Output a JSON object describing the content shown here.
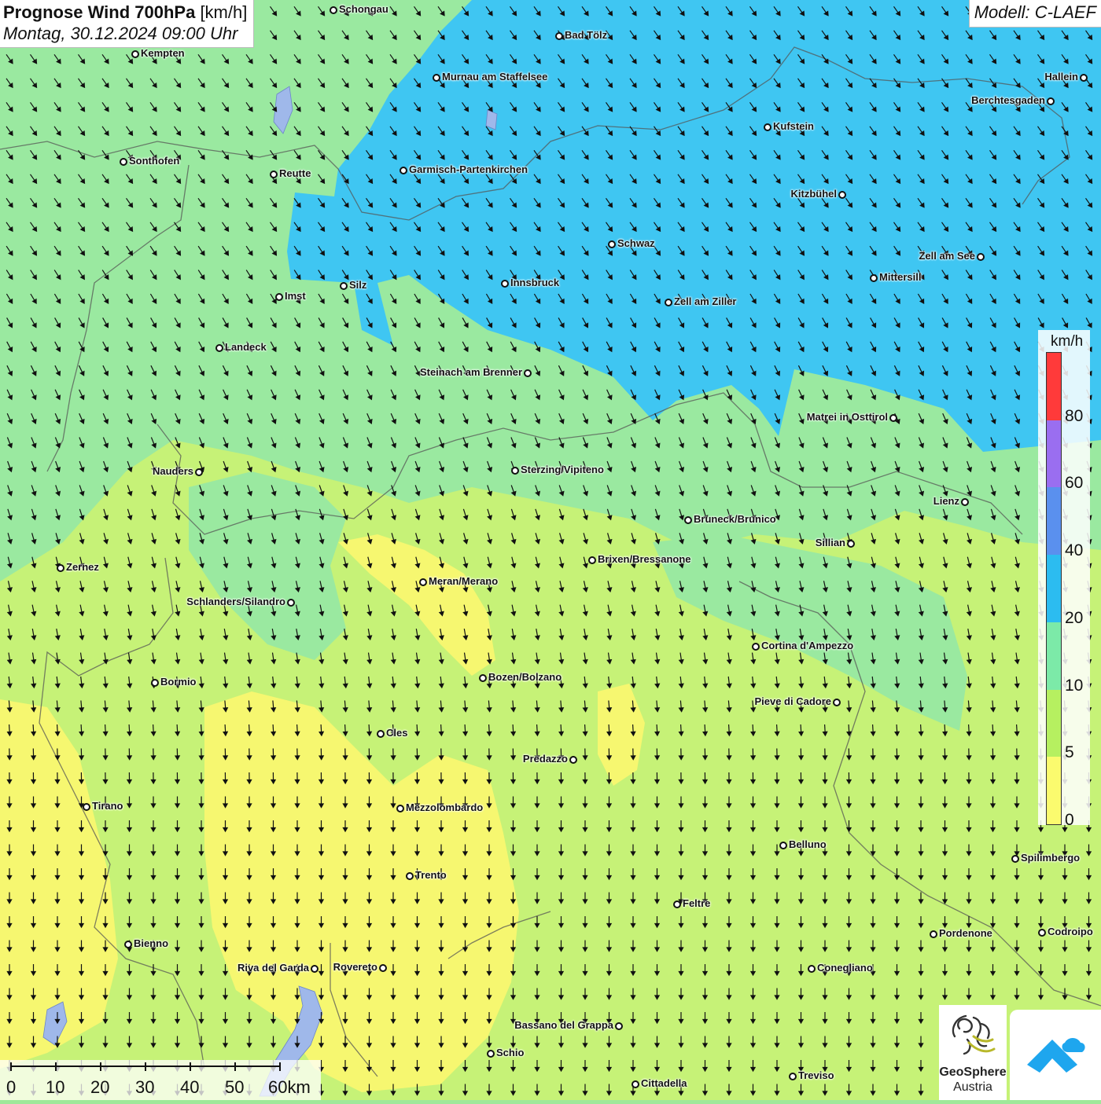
{
  "header": {
    "title_bold": "Prognose Wind 700hPa",
    "title_unit": "[km/h]",
    "datetime": "Montag, 30.12.2024 09:00 Uhr",
    "model": "Modell: C-LAEF"
  },
  "legend": {
    "unit": "km/h",
    "labels": [
      "80",
      "60",
      "40",
      "20",
      "10",
      "5",
      "0"
    ],
    "colors": [
      "#ff3a3a",
      "#9a6ef0",
      "#5a90ee",
      "#2cbcf0",
      "#7ceaa8",
      "#b6f060",
      "#fbfb6e"
    ]
  },
  "scale": {
    "labels": [
      "0",
      "10",
      "20",
      "30",
      "40",
      "50",
      "60km"
    ]
  },
  "logos": {
    "geosphere_name": "GeoSphere",
    "geosphere_sub": "Austria",
    "geosphere_icon": "geosphere-swirl-icon",
    "app_icon": "app-arrow-icon"
  },
  "colors": {
    "calm": "#f6f770",
    "light": "#c6f277",
    "moderate": "#9ae9a0",
    "strong": "#3fc6f2"
  },
  "cities": [
    {
      "name": "Schongau"
    },
    {
      "name": "Bad Tölz"
    },
    {
      "name": "Kempten"
    },
    {
      "name": "Murnau am Staffelsee"
    },
    {
      "name": "Hallein"
    },
    {
      "name": "Berchtesgaden"
    },
    {
      "name": "Kufstein"
    },
    {
      "name": "Sonthofen"
    },
    {
      "name": "Reutte"
    },
    {
      "name": "Garmisch-Partenkirchen"
    },
    {
      "name": "Kitzbühel"
    },
    {
      "name": "Schwaz"
    },
    {
      "name": "Zell am See"
    },
    {
      "name": "Mittersill"
    },
    {
      "name": "Innsbruck"
    },
    {
      "name": "Silz"
    },
    {
      "name": "Imst"
    },
    {
      "name": "Zell am Ziller"
    },
    {
      "name": "Landeck"
    },
    {
      "name": "Steinach am Brenner"
    },
    {
      "name": "Matrei in Osttirol"
    },
    {
      "name": "Nauders"
    },
    {
      "name": "Sterzing/Vipiteno"
    },
    {
      "name": "Lienz"
    },
    {
      "name": "Bruneck/Brunico"
    },
    {
      "name": "Sillian"
    },
    {
      "name": "Brixen/Bressanone"
    },
    {
      "name": "Zernez"
    },
    {
      "name": "Meran/Merano"
    },
    {
      "name": "Schlanders/Silandro"
    },
    {
      "name": "Cortina d'Ampezzo"
    },
    {
      "name": "Bozen/Bolzano"
    },
    {
      "name": "Bormio"
    },
    {
      "name": "Pieve di Cadore"
    },
    {
      "name": "Cles"
    },
    {
      "name": "Predazzo"
    },
    {
      "name": "Tirano"
    },
    {
      "name": "Mezzolombardo"
    },
    {
      "name": "Belluno"
    },
    {
      "name": "Spilimbergo"
    },
    {
      "name": "Trento"
    },
    {
      "name": "Feltre"
    },
    {
      "name": "Pordenone"
    },
    {
      "name": "Codroipo"
    },
    {
      "name": "Bienno"
    },
    {
      "name": "Riva del Garda"
    },
    {
      "name": "Rovereto"
    },
    {
      "name": "Conegliano"
    },
    {
      "name": "Bassano del Grappa"
    },
    {
      "name": "Schio"
    },
    {
      "name": "Treviso"
    },
    {
      "name": "Cittadella"
    }
  ]
}
